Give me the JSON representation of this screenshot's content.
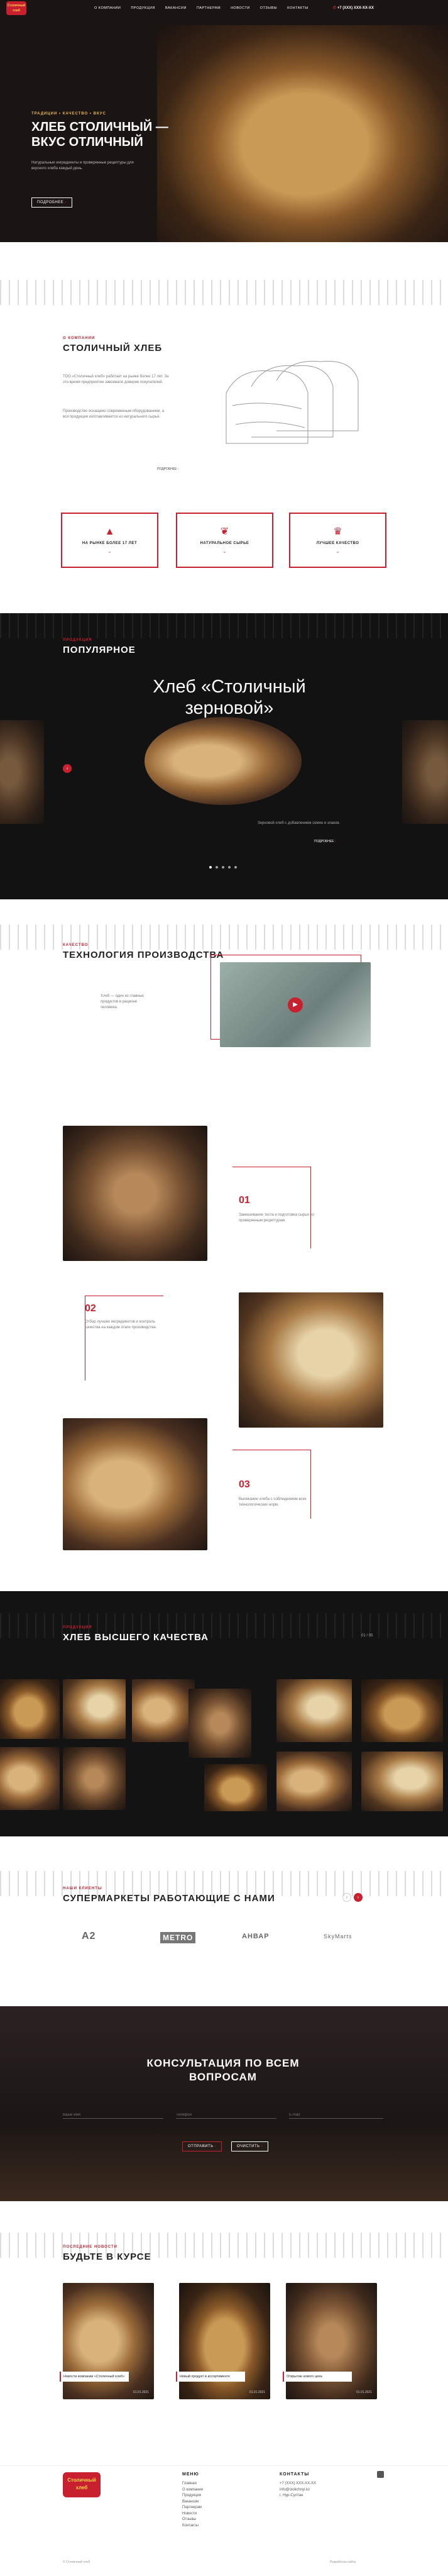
{
  "brand": {
    "logo_line1": "Столичный",
    "logo_line2": "хлеб",
    "logo_color": "#c8202f"
  },
  "nav": {
    "items": [
      "О компании",
      "Продукция",
      "Вакансии",
      "Партнерам",
      "Новости",
      "Отзывы",
      "Контакты"
    ],
    "phone": "+7 (XXX) XXX-XX-XX"
  },
  "hero": {
    "kicker": "Традиции • Качество • Вкус",
    "title": "Хлеб Столичный — вкус отличный",
    "text": "Натуральные ингредиенты и проверенные рецептуры для вкусного хлеба каждый день.",
    "button": "Подробнее"
  },
  "about": {
    "kicker": "О компании",
    "title": "Столичный хлеб",
    "p1": "ТОО «Столичный хлеб» работает на рынке более 17 лет. За это время предприятие завоевало доверие покупателей.",
    "p2": "Производство оснащено современным оборудованием, а вся продукция изготавливается из натурального сырья.",
    "more": "Подробнее"
  },
  "features": [
    {
      "label": "На рынке более 17 лет",
      "icon": "mountain-icon"
    },
    {
      "label": "Натуральное сырье",
      "icon": "wheat-icon"
    },
    {
      "label": "Лучшее качество",
      "icon": "cup-icon"
    }
  ],
  "popular": {
    "kicker": "Продукция",
    "title": "Популярное",
    "product_line1": "Хлеб «Столичный",
    "product_line2": "зерновой»",
    "desc": "Зерновой хлеб с добавлением семян и злаков.",
    "more": "Подробнее",
    "dots": 5
  },
  "tech": {
    "kicker": "Качество",
    "title": "Технология производства",
    "text": "Хлеб — один из главных продуктов в рационе человека."
  },
  "steps": [
    {
      "num": "01",
      "text": "Замешивание теста и подготовка сырья по проверенным рецептурам."
    },
    {
      "num": "02",
      "text": "Отбор лучших ингредиентов и контроль качества на каждом этапе производства."
    },
    {
      "num": "03",
      "text": "Выпекание хлеба с соблюдением всех технологических норм."
    }
  ],
  "quality": {
    "kicker": "Продукция",
    "title": "Хлеб высшего качества",
    "counter": "01 / 05"
  },
  "partners": {
    "kicker": "Наши клиенты",
    "title": "Супермаркеты работающие с нами",
    "logos": [
      "A2",
      "METRO",
      "АНВАР",
      "SkyMarts"
    ]
  },
  "consult": {
    "title_line1": "Консультация по всем",
    "title_line2": "вопросам",
    "placeholders": [
      "Ваше имя",
      "Телефон",
      "E-mail"
    ],
    "send": "Отправить",
    "reset": "Очистить"
  },
  "news": {
    "kicker": "Последние новости",
    "title": "Будьте в курсе",
    "items": [
      {
        "text": "Новости компании «Столичный хлеб»",
        "date": "01.01.2021"
      },
      {
        "text": "Новый продукт в ассортименте",
        "date": "01.01.2021"
      },
      {
        "text": "Открытие нового цеха",
        "date": "01.01.2021"
      }
    ]
  },
  "footer": {
    "menu_title": "Меню",
    "menu": [
      "Главная",
      "О компании",
      "Продукция",
      "Вакансии",
      "Партнерам",
      "Новости",
      "Отзывы",
      "Контакты"
    ],
    "contacts_title": "Контакты",
    "contacts": [
      "+7 (XXX) XXX-XX-XX",
      "info@stolichnyi.kz",
      "г. Нур-Султан"
    ],
    "copyright": "© Столичный хлеб",
    "dev": "Разработка сайта"
  }
}
